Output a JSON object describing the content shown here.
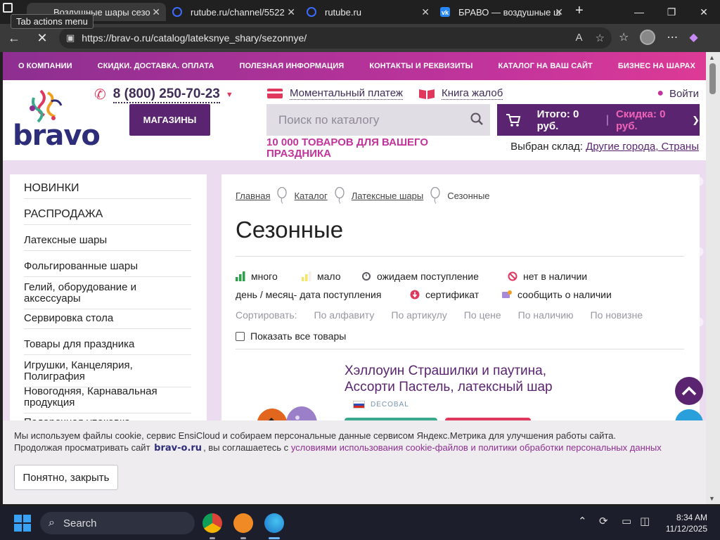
{
  "browser": {
    "tooltip": "Tab actions menu",
    "tabs": [
      {
        "title": "Воздушные шары сезо",
        "active": true
      },
      {
        "title": "rutube.ru/channel/5522",
        "active": false
      },
      {
        "title": "rutube.ru",
        "active": false
      },
      {
        "title": "БРАВО — воздушные ш",
        "active": false
      }
    ],
    "url": "https://brav-o.ru/catalog/lateksnye_shary/sezonnye/"
  },
  "topnav": {
    "items": [
      "О КОМПАНИИ",
      "СКИДКИ. ДОСТАВКА. ОПЛАТА",
      "ПОЛЕЗНАЯ ИНФОРМАЦИЯ",
      "КОНТАКТЫ И РЕКВИЗИТЫ",
      "КАТАЛОГ НА ВАШ САЙТ",
      "БИЗНЕС НА ШАРАХ"
    ]
  },
  "header": {
    "logo_text": "bravo",
    "phone": "8 (800) 250-70-23",
    "shops_button": "МАГАЗИНЫ",
    "instant_payment": "Моментальный платеж",
    "complaints_book": "Книга жалоб",
    "login": "Войти",
    "search_placeholder": "Поиск по каталогу",
    "promo": "10 000 ТОВАРОВ ДЛЯ ВАШЕГО ПРАЗДНИКА",
    "cart_total": "Итого: 0 руб.",
    "cart_discount": "Скидка: 0 руб.",
    "warehouse_label": "Выбран склад:",
    "warehouse_value": "Другие города, Страны"
  },
  "sidebar": {
    "items": [
      "НОВИНКИ",
      "РАСПРОДАЖА",
      "Латексные шары",
      "Фольгированные шары",
      "Гелий, оборудование и аксессуары",
      "Сервировка стола",
      "Товары для праздника",
      "Игрушки, Канцелярия, Полиграфия",
      "Новогодняя, Карнавальная продукция",
      "Подарочная упаковка"
    ]
  },
  "main": {
    "breadcrumbs": [
      "Главная",
      "Каталог",
      "Латексные шары",
      "Сезонные"
    ],
    "title": "Сезонные",
    "legend": {
      "many": "много",
      "few": "мало",
      "awaiting": "ожидаем поступление",
      "none": "нет в наличии",
      "date": "день / месяц- дата поступления",
      "certificate": "сертификат",
      "notify": "сообщить о наличии"
    },
    "sort": {
      "label": "Сортировать:",
      "options": [
        "По алфавиту",
        "По артикулу",
        "По цене",
        "По наличию",
        "По новизне"
      ]
    },
    "show_all": "Показать все товары",
    "product": {
      "title": "Хэллоуин Страшилки и паутина, Ассорти Пастель, латексный шар",
      "brand": "DECOBAL"
    }
  },
  "cookie": {
    "line1": "Мы используем файлы cookie, сервис EnsiCloud и собираем персональные данные сервисом Яндекс.Метрика для улучшения работы сайта.",
    "line2_prefix": "Продолжая просматривать сайт",
    "site": "brav-o.ru",
    "line2_mid": ", вы соглашаетесь с",
    "link": "условиями использования cookie-файлов и политики обработки персональных данных",
    "button": "Понятно, закрыть"
  },
  "taskbar": {
    "search": "Search",
    "time": "8:34 AM",
    "date": "11/12/2025"
  },
  "colors": {
    "brand_purple": "#5a2470",
    "accent_pink": "#c2349c",
    "nav_gradient_start": "#8d2f91",
    "nav_gradient_end": "#dd3a95"
  }
}
